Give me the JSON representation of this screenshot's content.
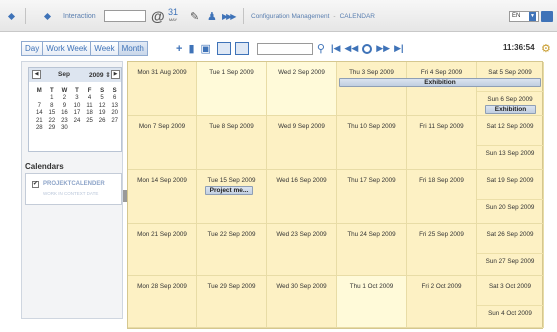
{
  "topbar": {
    "interaction_label": "Interaction",
    "interaction_value": "",
    "calendar_icon_number": "31",
    "calendar_icon_sub": "MAY",
    "breadcrumb": [
      "Configuration Management",
      "CALENDAR"
    ],
    "language": "EN"
  },
  "views": [
    "Day",
    "Work Week",
    "Week",
    "Month"
  ],
  "active_view": "Month",
  "search": {
    "value": ""
  },
  "clock": "11:36:54",
  "minical": {
    "month": "Sep",
    "year": "2009",
    "weekdays": [
      "M",
      "T",
      "W",
      "T",
      "F",
      "S",
      "S"
    ],
    "weeks": [
      [
        "",
        "1",
        "2",
        "3",
        "4",
        "5",
        "6"
      ],
      [
        "7",
        "8",
        "9",
        "10",
        "11",
        "12",
        "13"
      ],
      [
        "14",
        "15",
        "16",
        "17",
        "18",
        "19",
        "20"
      ],
      [
        "21",
        "22",
        "23",
        "24",
        "25",
        "26",
        "27"
      ],
      [
        "28",
        "29",
        "30",
        "",
        "",
        "",
        ""
      ]
    ]
  },
  "calendars": {
    "title": "Calendars",
    "items": [
      {
        "name": "PROJEKTCALENDER",
        "sub": "WORK IN CONTEXT DATE",
        "checked": true
      }
    ]
  },
  "month_grid": {
    "weeks": [
      {
        "days": [
          "Mon 31 Aug 2009",
          "Tue 1 Sep 2009",
          "Wed 2 Sep 2009",
          "Thu 3 Sep 2009",
          "Fri 4 Sep 2009",
          "Sat 5 Sep 2009"
        ],
        "sunday": "Sun 6 Sep 2009"
      },
      {
        "days": [
          "Mon 7 Sep 2009",
          "Tue 8 Sep 2009",
          "Wed 9 Sep 2009",
          "Thu 10 Sep 2009",
          "Fri 11 Sep 2009",
          "Sat 12 Sep 2009"
        ],
        "sunday": "Sun 13 Sep 2009"
      },
      {
        "days": [
          "Mon 14 Sep 2009",
          "Tue 15 Sep 2009",
          "Wed 16 Sep 2009",
          "Thu 17 Sep 2009",
          "Fri 18 Sep 2009",
          "Sat 19 Sep 2009"
        ],
        "sunday": "Sun 20 Sep 2009"
      },
      {
        "days": [
          "Mon 21 Sep 2009",
          "Tue 22 Sep 2009",
          "Wed 23 Sep 2009",
          "Thu 24 Sep 2009",
          "Fri 25 Sep 2009",
          "Sat 26 Sep 2009"
        ],
        "sunday": "Sun 27 Sep 2009"
      },
      {
        "days": [
          "Mon 28 Sep 2009",
          "Tue 29 Sep 2009",
          "Wed 30 Sep 2009",
          "Thu 1 Oct 2009",
          "Fri 2 Oct 2009",
          "Sat 3 Oct 2009"
        ],
        "sunday": "Sun 4 Oct 2009"
      }
    ],
    "events": [
      {
        "title": "Exhibition",
        "week": 0,
        "start": 3,
        "end": 5,
        "row": "main"
      },
      {
        "title": "Exhibition",
        "week": 0,
        "start": 5,
        "end": 5,
        "row": "sunday"
      },
      {
        "title": "Project me...",
        "week": 2,
        "start": 1,
        "end": 1,
        "row": "main"
      }
    ]
  },
  "colors": {
    "accent": "#3f73b8",
    "grid_bg": "#fdf1c4",
    "grid_light": "#fffad9"
  }
}
